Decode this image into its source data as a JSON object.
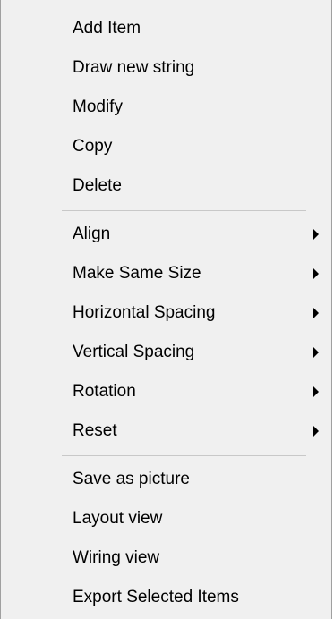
{
  "menu": {
    "groups": [
      {
        "items": [
          {
            "label": "Add Item"
          },
          {
            "label": "Draw new string"
          },
          {
            "label": "Modify"
          },
          {
            "label": "Copy"
          },
          {
            "label": "Delete"
          }
        ]
      },
      {
        "items": [
          {
            "label": "Align",
            "submenu_icon": "chevron-right-icon"
          },
          {
            "label": "Make Same Size",
            "submenu_icon": "chevron-right-icon"
          },
          {
            "label": "Horizontal Spacing",
            "submenu_icon": "chevron-right-icon"
          },
          {
            "label": "Vertical Spacing",
            "submenu_icon": "chevron-right-icon"
          },
          {
            "label": "Rotation",
            "submenu_icon": "chevron-right-icon"
          },
          {
            "label": "Reset",
            "submenu_icon": "chevron-right-icon"
          }
        ]
      },
      {
        "items": [
          {
            "label": "Save as picture"
          },
          {
            "label": "Layout view"
          },
          {
            "label": "Wiring view"
          },
          {
            "label": "Export Selected Items"
          }
        ]
      }
    ],
    "colors": {
      "background": "#f0f0f0",
      "separator": "#c8c8c8",
      "text": "#000000",
      "border": "#a0a0a0"
    }
  }
}
